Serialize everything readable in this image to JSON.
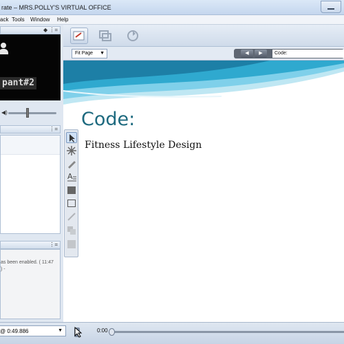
{
  "window": {
    "title": "rate – MRS.POLLY'S VIRTUAL OFFICE"
  },
  "menu": {
    "items": [
      "ack",
      "Tools",
      "Window",
      "Help"
    ]
  },
  "video": {
    "participant_name": "pant#2"
  },
  "viewer": {
    "fit_label": "Fit Page",
    "code_label": "Code:"
  },
  "slide": {
    "title": "Code:",
    "subtitle": "Fitness Lifestyle Design"
  },
  "chat": {
    "message_line1": "as been enabled. ( 11:47",
    "message_line2": ") -"
  },
  "playback": {
    "recording_label": "@ 0:49.886",
    "time": "0:00"
  },
  "colors": {
    "accent_teal": "#1e6a7f",
    "wave_light": "#bfe7f3"
  }
}
